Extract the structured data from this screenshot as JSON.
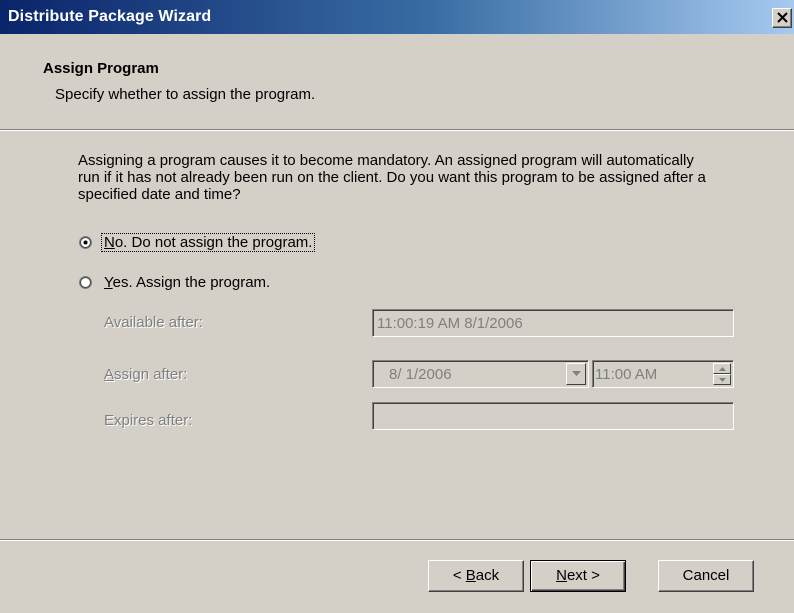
{
  "window": {
    "title": "Distribute Package Wizard",
    "close_icon": "close-icon"
  },
  "header": {
    "title": "Assign Program",
    "subtitle": "Specify whether to assign the program."
  },
  "description": "Assigning a program causes it to become mandatory. An assigned program will automatically run if it has not already been run on the client. Do you want this program to be assigned after a specified date and time?",
  "options": {
    "no": {
      "mnemonic": "N",
      "label_rest": "o. Do not assign the program.",
      "selected": true
    },
    "yes": {
      "mnemonic": "Y",
      "label_rest": "es. Assign the program.",
      "selected": false
    }
  },
  "fields": {
    "available_after": {
      "label": "Available after:",
      "value": "11:00:19 AM 8/1/2006"
    },
    "assign_after": {
      "label_mnemonic": "A",
      "label_rest": "ssign after:",
      "date_value": "8/ 1/2006",
      "time_value": "11:00 AM"
    },
    "expires_after": {
      "label": "Expires after:",
      "value": ""
    }
  },
  "buttons": {
    "back": {
      "prefix": "< ",
      "mnemonic": "B",
      "rest": "ack"
    },
    "next": {
      "mnemonic": "N",
      "rest": "ext >"
    },
    "cancel": {
      "label": "Cancel"
    }
  },
  "colors": {
    "title_start": "#0a246a",
    "title_end": "#a6caf0",
    "face": "#d4d0c8",
    "disabled_text": "#808080"
  }
}
